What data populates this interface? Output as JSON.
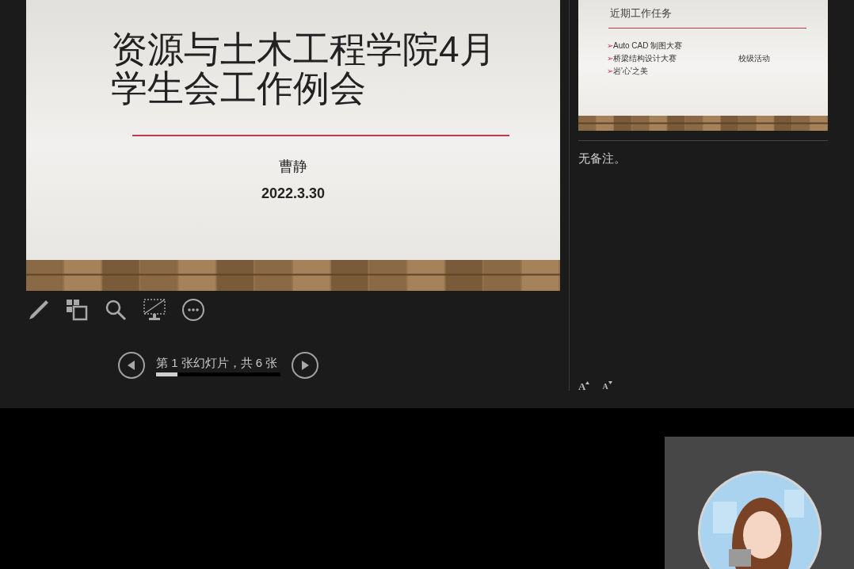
{
  "current_slide": {
    "title_lines": [
      "资源与土木工程学院4月",
      "学生会工作例会"
    ],
    "author": "曹静",
    "date": "2022.3.30"
  },
  "toolbar": [
    {
      "kind": "pen"
    },
    {
      "kind": "slides"
    },
    {
      "kind": "zoom"
    },
    {
      "kind": "black_screen"
    },
    {
      "kind": "more"
    }
  ],
  "navigation": {
    "counter": "第 1 张幻灯片，共 6 张",
    "level": 0.17
  },
  "next_slide": {
    "title": "近期工作任务",
    "bullets": [
      {
        "marker": "➢",
        "text": "Auto CAD 制图大赛"
      },
      {
        "marker": "➢",
        "text": "桥梁结构设计大赛"
      },
      {
        "marker": "➢",
        "text": "岩'心'之美"
      }
    ],
    "side_note": "校级活动"
  },
  "notes": {
    "text": "无备注。"
  },
  "font_buttons": [
    {
      "kind": "increase",
      "label": "A"
    },
    {
      "kind": "decrease",
      "label": "A"
    }
  ],
  "video_tile": {
    "kind": "avatar"
  }
}
